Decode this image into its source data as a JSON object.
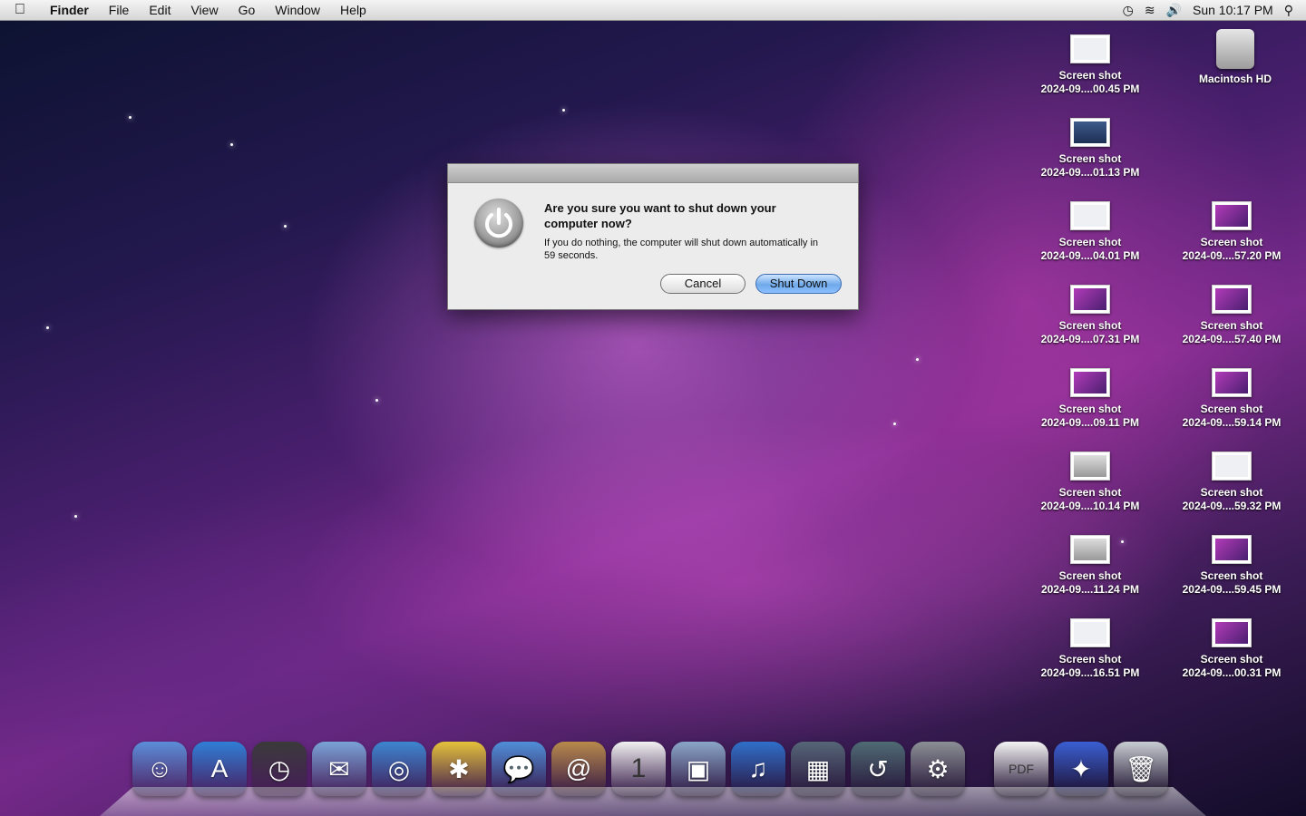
{
  "menubar": {
    "apple_icon": "apple-icon",
    "app_name": "Finder",
    "menus": [
      "File",
      "Edit",
      "View",
      "Go",
      "Window",
      "Help"
    ],
    "clock": "Sun 10:17 PM",
    "status_icons": [
      "time-machine-icon",
      "wifi-icon",
      "volume-icon",
      "spotlight-icon"
    ]
  },
  "desktop": {
    "hd_label": "Macintosh HD",
    "icons": [
      {
        "line1": "Screen shot",
        "line2": "2024-09....00.45 PM"
      },
      {
        "line1": "Screen shot",
        "line2": "2024-09....01.13 PM"
      },
      {
        "line1": "Screen shot",
        "line2": "2024-09....04.01 PM"
      },
      {
        "line1": "Screen shot",
        "line2": "2024-09....57.20 PM"
      },
      {
        "line1": "Screen shot",
        "line2": "2024-09....07.31 PM"
      },
      {
        "line1": "Screen shot",
        "line2": "2024-09....57.40 PM"
      },
      {
        "line1": "Screen shot",
        "line2": "2024-09....09.11 PM"
      },
      {
        "line1": "Screen shot",
        "line2": "2024-09....59.14 PM"
      },
      {
        "line1": "Screen shot",
        "line2": "2024-09....10.14 PM"
      },
      {
        "line1": "Screen shot",
        "line2": "2024-09....59.32 PM"
      },
      {
        "line1": "Screen shot",
        "line2": "2024-09....11.24 PM"
      },
      {
        "line1": "Screen shot",
        "line2": "2024-09....59.45 PM"
      },
      {
        "line1": "Screen shot",
        "line2": "2024-09....16.51 PM"
      },
      {
        "line1": "Screen shot",
        "line2": "2024-09....00.31 PM"
      }
    ]
  },
  "dialog": {
    "message": "Are you sure you want to shut down your computer now?",
    "info": "If you do nothing, the computer will shut down automatically in 59 seconds.",
    "cancel_label": "Cancel",
    "confirm_label": "Shut Down"
  },
  "dock": {
    "apps": [
      {
        "name": "finder",
        "icon": "finder-icon",
        "color": "#5b8ed8",
        "glyph": "☺"
      },
      {
        "name": "app-store",
        "icon": "app-store-icon",
        "color": "#2f7fd6",
        "glyph": "A"
      },
      {
        "name": "dashboard",
        "icon": "dashboard-icon",
        "color": "#3a3a3a",
        "glyph": "◷"
      },
      {
        "name": "mail-stamp",
        "icon": "mail-stamp-icon",
        "color": "#7aa3d6",
        "glyph": "✉"
      },
      {
        "name": "safari",
        "icon": "safari-icon",
        "color": "#3c86d0",
        "glyph": "◎"
      },
      {
        "name": "spider-app",
        "icon": "spider-icon",
        "color": "#e4c13a",
        "glyph": "✱"
      },
      {
        "name": "ichat",
        "icon": "ichat-icon",
        "color": "#4f8fd8",
        "glyph": "💬"
      },
      {
        "name": "address-book",
        "icon": "address-book-icon",
        "color": "#b78a4a",
        "glyph": "@"
      },
      {
        "name": "ical",
        "icon": "calendar-icon",
        "color": "#f1f1f1",
        "glyph": "1"
      },
      {
        "name": "iphoto",
        "icon": "iphoto-icon",
        "color": "#8aa6c8",
        "glyph": "▣"
      },
      {
        "name": "itunes",
        "icon": "itunes-icon",
        "color": "#2f6fc9",
        "glyph": "♫"
      },
      {
        "name": "spaces",
        "icon": "spaces-icon",
        "color": "#556677",
        "glyph": "▦"
      },
      {
        "name": "time-machine",
        "icon": "time-machine-icon",
        "color": "#4f6b74",
        "glyph": "↺"
      },
      {
        "name": "system-preferences",
        "icon": "system-preferences-icon",
        "color": "#8b8f95",
        "glyph": "⚙"
      }
    ],
    "others": [
      {
        "name": "pdf-document",
        "icon": "pdf-document-icon",
        "color": "#f4f4f4",
        "glyph": "PDF"
      },
      {
        "name": "downloads-stack",
        "icon": "downloads-icon",
        "color": "#3a5fd2",
        "glyph": "✦"
      },
      {
        "name": "trash",
        "icon": "trash-icon",
        "color": "#c8cdd2",
        "glyph": "🗑"
      }
    ]
  }
}
